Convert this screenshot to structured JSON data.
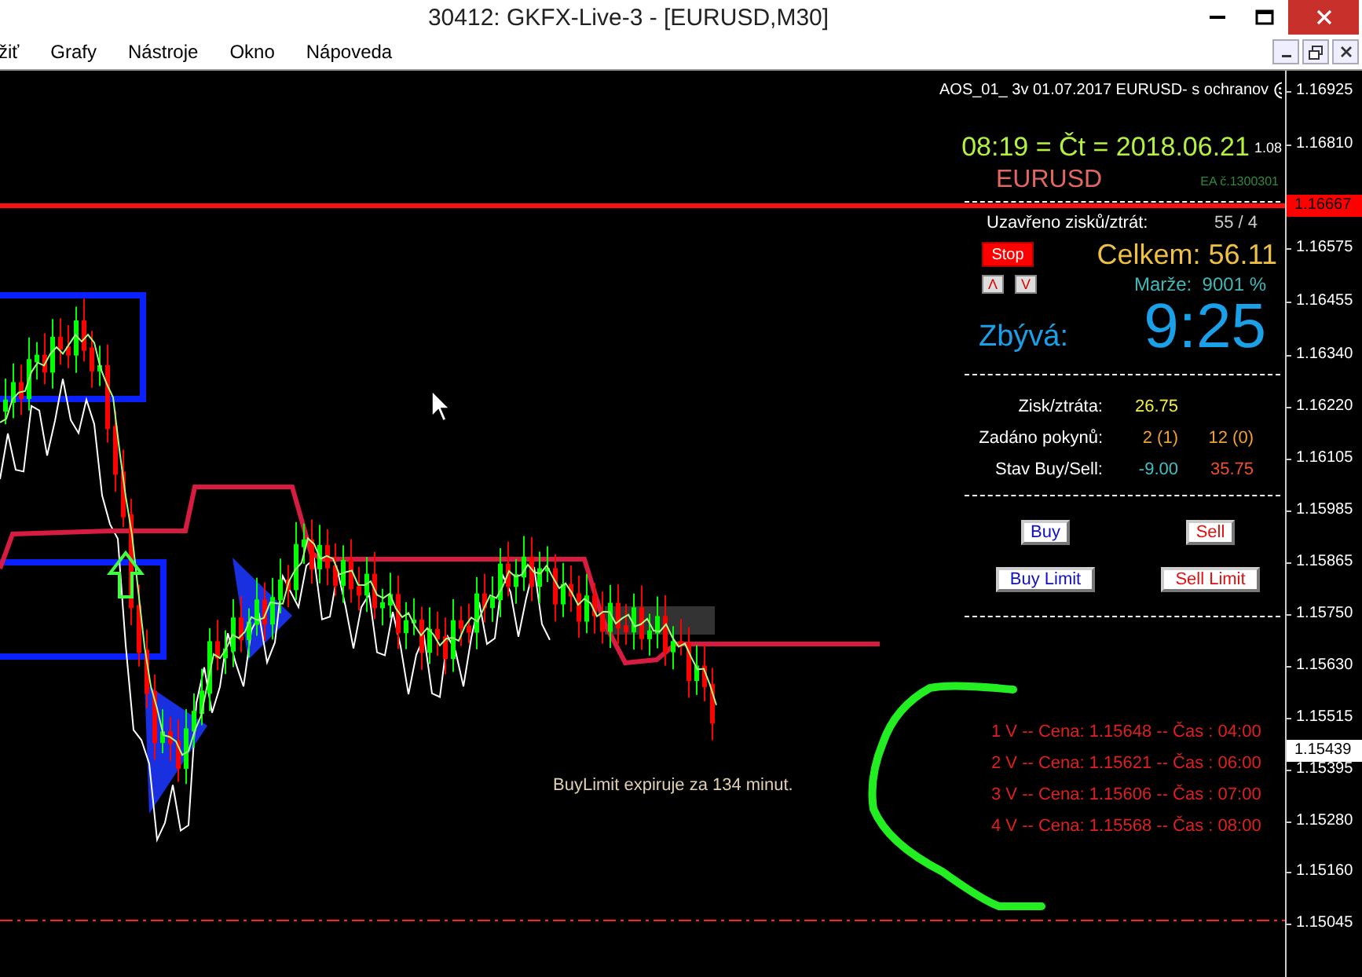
{
  "window": {
    "title": "30412: GKFX-Live-3 - [EURUSD,M30]"
  },
  "menu": [
    "žiť",
    "Grafy",
    "Nástroje",
    "Okno",
    "Nápoveda"
  ],
  "panel": {
    "header": "AOS_01_ 3v 01.07.2017 EURUSD- s ochranov",
    "datetime": "08:19 = Čt = 2018.06.21",
    "datetime_suffix": "1.08",
    "symbol": "EURUSD",
    "ea_number": "EA č.1300301",
    "closed_label": "Uzavřeno zisků/ztrát:",
    "closed_value": "55 / 4",
    "stop_button": "Stop",
    "total": "Celkem: 56.11",
    "arrow_buttons": [
      "Λ",
      "V"
    ],
    "margin": "Marže:  9001 %",
    "remaining_label": "Zbývá:",
    "remaining_value": "9:25",
    "stats": [
      {
        "label": "Zisk/ztráta:",
        "values": [
          {
            "text": "26.75",
            "color": "#f0f040"
          }
        ]
      },
      {
        "label": "Zadáno pokynů:",
        "values": [
          {
            "text": "2 (1)",
            "color": "#f0a030"
          },
          {
            "text": "12 (0)",
            "color": "#f0a030"
          }
        ]
      },
      {
        "label": "Stav Buy/Sell:",
        "values": [
          {
            "text": "-9.00",
            "color": "#40c0c0"
          },
          {
            "text": "35.75",
            "color": "#f05030"
          }
        ]
      }
    ],
    "order_buttons": [
      {
        "label": "Buy",
        "kind": "buy"
      },
      {
        "label": "Sell",
        "kind": "sell"
      },
      {
        "label": "Buy Limit",
        "kind": "buy"
      },
      {
        "label": "Sell Limit",
        "kind": "sell"
      }
    ]
  },
  "orders": [
    "1 V -- Cena: 1.15648 -- Čas : 04:00",
    "2 V -- Cena: 1.15621 -- Čas : 06:00",
    "3 V -- Cena: 1.15606 -- Čas : 07:00",
    "4 V -- Cena: 1.15568 -- Čas : 08:00"
  ],
  "chart_note": "BuyLimit expiruje za 134 minut.",
  "price_axis": {
    "labels": [
      "1.16925",
      "1.16810",
      "1.16575",
      "1.16455",
      "1.16340",
      "1.16220",
      "1.16105",
      "1.15985",
      "1.15865",
      "1.15750",
      "1.15630",
      "1.15515",
      "1.15395",
      "1.15280",
      "1.15160",
      "1.15045"
    ],
    "level_price": "1.16667",
    "bid_price": "1.15439"
  }
}
